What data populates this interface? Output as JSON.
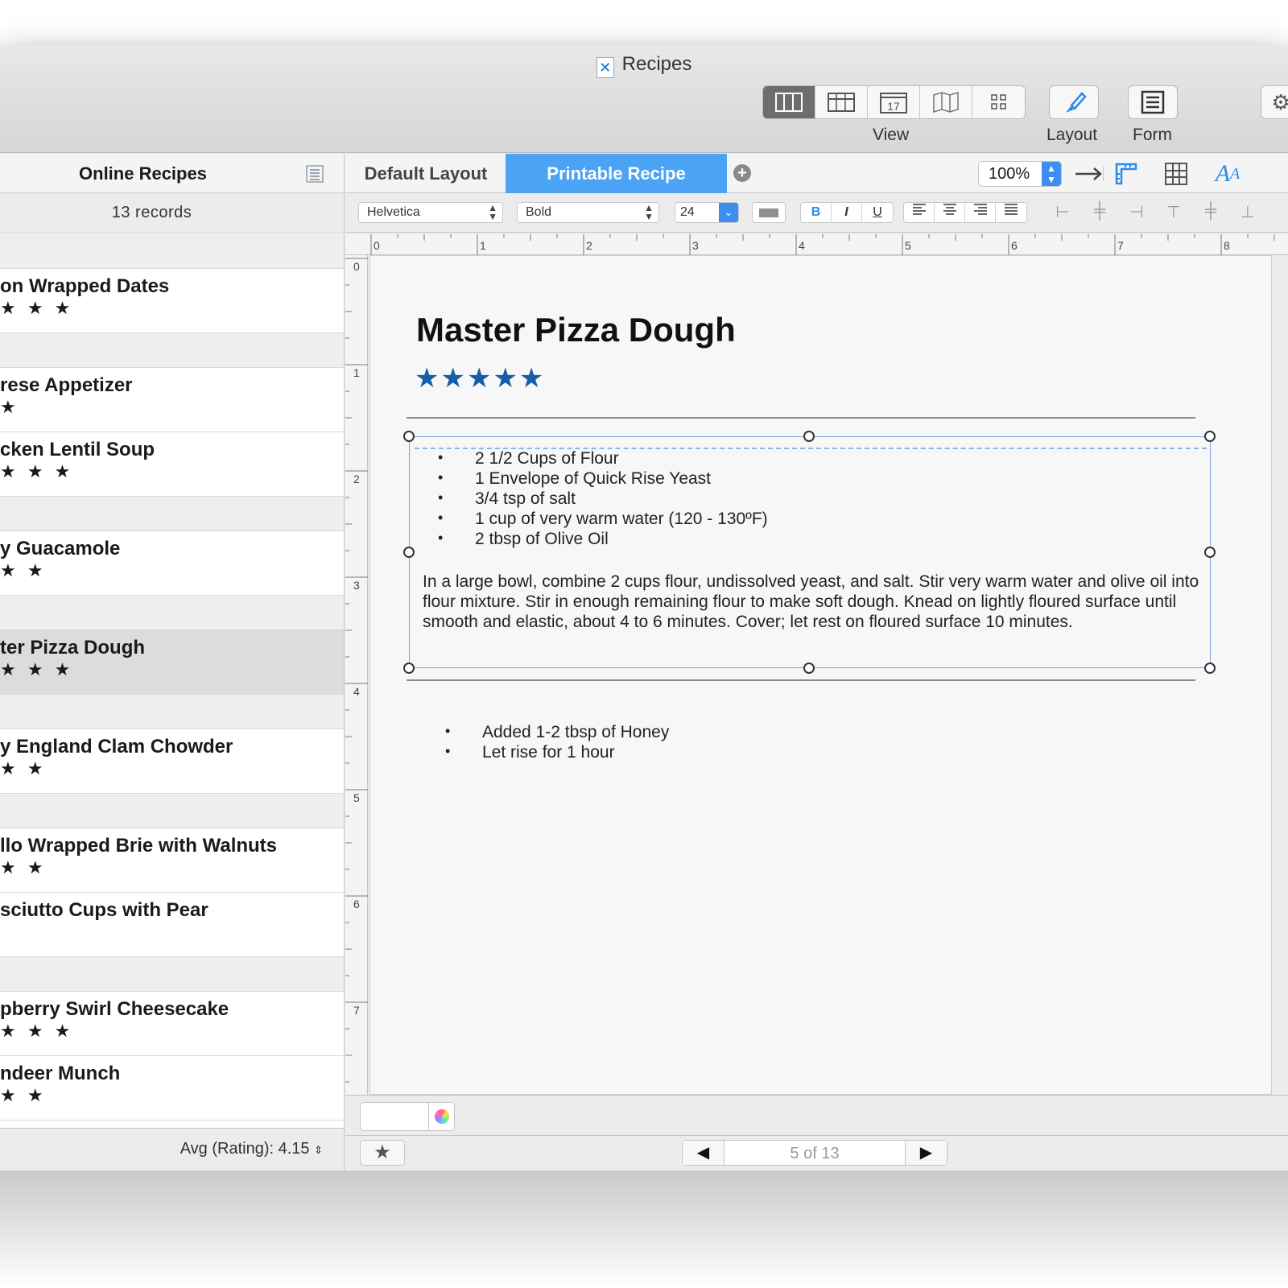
{
  "window": {
    "title": "Recipes",
    "toolbar": {
      "view_label": "View",
      "layout_label": "Layout",
      "form_label": "Form",
      "view_modes": [
        "columns-icon",
        "table-icon",
        "calendar-icon",
        "map-icon",
        "grid-icon"
      ],
      "calendar_day": "17",
      "active_view_mode": "columns-icon"
    }
  },
  "sidebar": {
    "title": "Online Recipes",
    "record_count": "13 records",
    "records": [
      {
        "name": "on Wrapped Dates",
        "stars": "★ ★ ★",
        "selected": false
      },
      {
        "name": "rese Appetizer",
        "stars": "★",
        "selected": false
      },
      {
        "name": "cken Lentil Soup",
        "stars": "★ ★ ★",
        "selected": false
      },
      {
        "name": "y Guacamole",
        "stars": "★ ★",
        "selected": false
      },
      {
        "name": "ter Pizza Dough",
        "stars": "★ ★ ★",
        "selected": true
      },
      {
        "name": "y England Clam Chowder",
        "stars": "★ ★",
        "selected": false
      },
      {
        "name": "llo Wrapped Brie with Walnuts",
        "stars": "★ ★",
        "selected": false
      },
      {
        "name": "sciutto Cups with Pear",
        "stars": "",
        "selected": false
      },
      {
        "name": "pberry Swirl Cheesecake",
        "stars": "★ ★ ★",
        "selected": false
      },
      {
        "name": "ndeer Munch",
        "stars": "★ ★",
        "selected": false
      }
    ],
    "footer_summary": "Avg (Rating): 4.15"
  },
  "layouts": {
    "tabs": [
      "Default Layout",
      "Printable Recipe"
    ],
    "active_tab": "Printable Recipe",
    "zoom": "100%"
  },
  "format_bar": {
    "font": "Helvetica",
    "style": "Bold",
    "size": "24",
    "style_buttons": [
      "B",
      "I",
      "U"
    ],
    "alignment_icons": [
      "align-left-icon",
      "align-center-icon",
      "align-right-icon",
      "align-justify-icon"
    ]
  },
  "ruler": {
    "horizontal": [
      "0",
      "1",
      "2",
      "3",
      "4",
      "5",
      "6",
      "7",
      "8"
    ],
    "vertical": [
      "0",
      "1",
      "2",
      "3",
      "4",
      "5",
      "6",
      "7"
    ]
  },
  "recipe": {
    "title": "Master Pizza Dough",
    "rating": "★★★★★",
    "rating_value": 5,
    "rating_color": "#175ea7",
    "ingredients": [
      "2 1/2 Cups of Flour",
      "1 Envelope of Quick Rise Yeast",
      "3/4 tsp of salt",
      "1 cup of very warm water (120 - 130ºF)",
      "2 tbsp of Olive Oil"
    ],
    "instructions": "In a large bowl, combine 2 cups flour, undissolved yeast, and salt. Stir very warm water and olive oil into flour mixture. Stir in enough remaining flour to make soft dough. Knead on lightly floured surface until smooth and elastic, about 4 to 6 minutes. Cover; let rest on floured surface 10 minutes.",
    "notes": [
      "Added 1-2 tbsp of Honey",
      "Let rise for 1 hour"
    ]
  },
  "navigation": {
    "position": "5 of 13"
  },
  "colors": {
    "accent": "#4aa3f4",
    "selection_outline": "#7fa4dc"
  }
}
